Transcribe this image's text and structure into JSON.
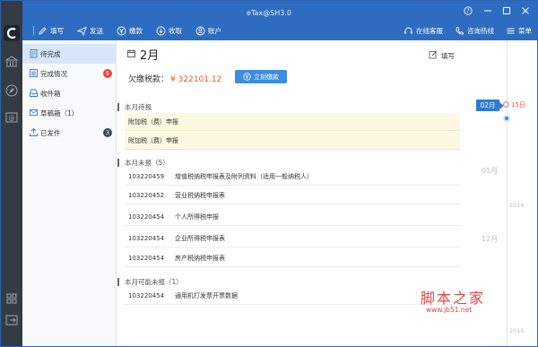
{
  "window": {
    "title": "eTax@SH3.0"
  },
  "toolbar": {
    "items": [
      {
        "label": "填写",
        "icon": "edit-icon"
      },
      {
        "label": "发送",
        "icon": "send-icon"
      },
      {
        "label": "缴款",
        "icon": "yen-circle-icon"
      },
      {
        "label": "收取",
        "icon": "download-icon"
      },
      {
        "label": "账户",
        "icon": "user-circle-icon"
      }
    ],
    "right": [
      {
        "label": "在线客服",
        "icon": "headset-icon"
      },
      {
        "label": "咨询热线",
        "icon": "phone-icon"
      },
      {
        "label": "菜单",
        "icon": "menu-icon"
      }
    ]
  },
  "sidebar": {
    "items": [
      {
        "label": "待完成",
        "icon": "clipboard-icon",
        "active": true
      },
      {
        "label": "完成情况",
        "icon": "list-icon",
        "badge": "5",
        "badge_color": "#e04b3a"
      },
      {
        "label": "收件箱",
        "icon": "inbox-icon"
      },
      {
        "label": "草稿箱（1）",
        "icon": "draft-icon"
      },
      {
        "label": "已发件",
        "icon": "sent-icon",
        "badge": "3",
        "badge_color": "#3a4a66"
      }
    ]
  },
  "main": {
    "month": "2月",
    "write_label": "填写",
    "owed_label": "欠缴税款：",
    "owed_value": "¥ 322101.12",
    "pay_button": "立刻缴款",
    "sections": [
      {
        "title": "本月待报",
        "rows": [
          {
            "code": "",
            "name": "附加税（费）申报"
          },
          {
            "code": "",
            "name": "附加税（费）申报"
          }
        ]
      },
      {
        "title": "本月未报（5）",
        "rows": [
          {
            "code": "103220459",
            "name": "增值税纳税申报表及附列资料（适用一般纳税人）"
          },
          {
            "code": "103220452",
            "name": "营业税纳税申报表"
          },
          {
            "code": "103220454",
            "name": "个人所得税申报"
          },
          {
            "code": "103220454",
            "name": "企业所得税申报表"
          },
          {
            "code": "103220454",
            "name": "房产税纳税申报表"
          }
        ]
      },
      {
        "title": "本月可能未报（1）",
        "rows": [
          {
            "code": "103220454",
            "name": "通用机打发票开票数据"
          }
        ]
      }
    ]
  },
  "timeline": {
    "active_month": "02月",
    "today": "15日",
    "months": [
      "01月",
      "12月"
    ],
    "years": [
      "2016",
      "2015"
    ]
  },
  "watermark": {
    "text": "脚本之家",
    "url": "www.jb51.net"
  }
}
